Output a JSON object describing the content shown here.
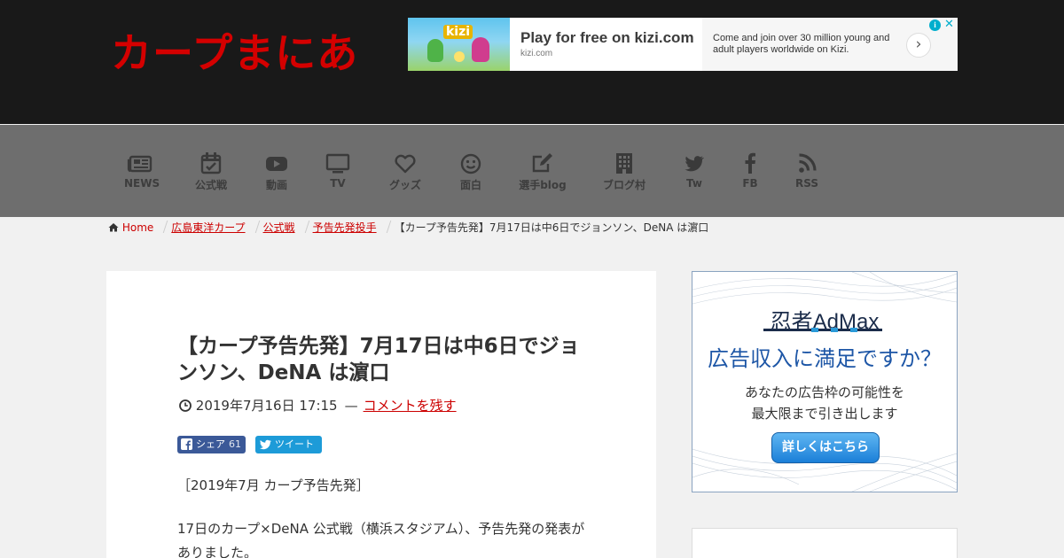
{
  "site": {
    "logo_text": "カープまにあ"
  },
  "top_ad": {
    "headline": "Play for free on kizi.com",
    "domain": "kizi.com",
    "description": "Come and join over 30 million young and adult players worldwide on Kizi.",
    "thumb_word": "kizi",
    "arrow_symbol": "›",
    "info_symbol": "i",
    "close_symbol": "✕"
  },
  "nav": {
    "items": [
      {
        "label": "NEWS",
        "icon": "newspaper-icon"
      },
      {
        "label": "公式戦",
        "icon": "calendar-check-icon"
      },
      {
        "label": "動画",
        "icon": "youtube-icon"
      },
      {
        "label": "TV",
        "icon": "tv-icon"
      },
      {
        "label": "グッズ",
        "icon": "heart-icon"
      },
      {
        "label": "面白",
        "icon": "smile-icon"
      },
      {
        "label": "選手blog",
        "icon": "edit-icon"
      },
      {
        "label": "ブログ村",
        "icon": "building-icon"
      },
      {
        "label": "Tw",
        "icon": "twitter-icon"
      },
      {
        "label": "FB",
        "icon": "facebook-icon"
      },
      {
        "label": "RSS",
        "icon": "rss-icon"
      }
    ]
  },
  "breadcrumb": {
    "home": "Home",
    "items": [
      "広島東洋カープ",
      "公式戦",
      "予告先発投手"
    ],
    "current": "【カープ予告先発】7月17日は中6日でジョンソン、DeNA は濵口"
  },
  "article": {
    "title": "【カープ予告先発】7月17日は中6日でジョンソン、DeNA は濵口",
    "date": "2019年7月16日 17:15",
    "dash": "—",
    "comment_link": "コメントを残す",
    "share": {
      "fb_label": "シェア",
      "fb_count": "61",
      "tw_label": "ツイート"
    },
    "paragraph1": "［2019年7月 カープ予告先発］",
    "paragraph2": "17日のカープ×DeNA 公式戦（横浜スタジアム）、予告先発の発表がありました。"
  },
  "side_ad": {
    "brand": "忍者AdMax",
    "headline": "広告収入に満足ですか？",
    "sub_line1": "あなたの広告枠の可能性を",
    "sub_line2": "最大限まで引き出します",
    "button": "詳しくはこちら"
  },
  "colors": {
    "header_bg": "#191919",
    "nav_bg": "#6e6e6e",
    "logo": "#d40000",
    "link": "#cc0000",
    "facebook": "#3b5998",
    "twitter": "#1d9bd8",
    "admax_blue": "#1d56a6"
  }
}
